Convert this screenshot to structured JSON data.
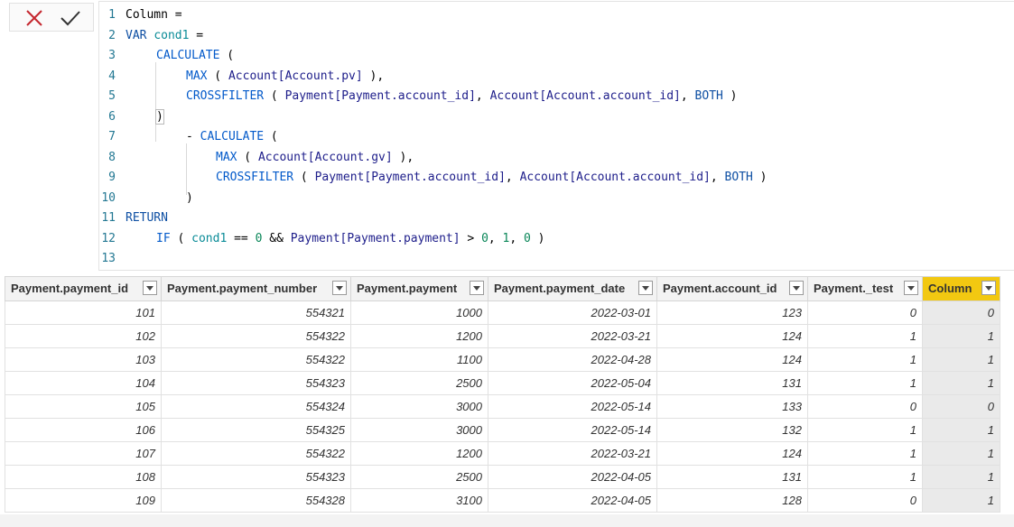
{
  "toolbar": {
    "cancel_icon": "x-icon",
    "commit_icon": "check-icon"
  },
  "formula": {
    "lines": [
      {
        "n": "1"
      },
      {
        "n": "2"
      },
      {
        "n": "3"
      },
      {
        "n": "4"
      },
      {
        "n": "5"
      },
      {
        "n": "6"
      },
      {
        "n": "7"
      },
      {
        "n": "8"
      },
      {
        "n": "9"
      },
      {
        "n": "10"
      },
      {
        "n": "11"
      },
      {
        "n": "12"
      },
      {
        "n": "13"
      }
    ],
    "t": {
      "l1": "Column =",
      "l2a": "VAR ",
      "l2b": "cond1",
      "l2c": " =",
      "l3a": "CALCULATE",
      "l3b": " (",
      "l4a": "MAX",
      "l4b": " ( ",
      "l4c": "Account[Account.pv]",
      "l4d": " ),",
      "l5a": "CROSSFILTER",
      "l5b": " ( ",
      "l5c": "Payment[Payment.account_id]",
      "l5d": ", ",
      "l5e": "Account[Account.account_id]",
      "l5f": ", ",
      "l5g": "BOTH",
      "l5h": " )",
      "l6a": ")",
      "l7a": "- ",
      "l7b": "CALCULATE",
      "l7c": " (",
      "l8a": "MAX",
      "l8b": " ( ",
      "l8c": "Account[Account.gv]",
      "l8d": " ),",
      "l9a": "CROSSFILTER",
      "l9b": " ( ",
      "l9c": "Payment[Payment.account_id]",
      "l9d": ", ",
      "l9e": "Account[Account.account_id]",
      "l9f": ", ",
      "l9g": "BOTH",
      "l9h": " )",
      "l10a": ")",
      "l11a": "RETURN",
      "l12a": "IF",
      "l12b": " ( ",
      "l12c": "cond1",
      "l12d": " == ",
      "l12e": "0",
      "l12f": " && ",
      "l12g": "Payment[Payment.payment]",
      "l12h": " > ",
      "l12i": "0",
      "l12j": ", ",
      "l12k": "1",
      "l12l": ", ",
      "l12m": "0",
      "l12n": " )"
    }
  },
  "table": {
    "columns": [
      "Payment.payment_id",
      "Payment.payment_number",
      "Payment.payment",
      "Payment.payment_date",
      "Payment.account_id",
      "Payment._test",
      "Column"
    ],
    "selected_column_color": "#f2c811",
    "rows": [
      [
        "101",
        "554321",
        "1000",
        "2022-03-01",
        "123",
        "0",
        "0"
      ],
      [
        "102",
        "554322",
        "1200",
        "2022-03-21",
        "124",
        "1",
        "1"
      ],
      [
        "103",
        "554322",
        "1100",
        "2022-04-28",
        "124",
        "1",
        "1"
      ],
      [
        "104",
        "554323",
        "2500",
        "2022-05-04",
        "131",
        "1",
        "1"
      ],
      [
        "105",
        "554324",
        "3000",
        "2022-05-14",
        "133",
        "0",
        "0"
      ],
      [
        "106",
        "554325",
        "3000",
        "2022-05-14",
        "132",
        "1",
        "1"
      ],
      [
        "107",
        "554322",
        "1200",
        "2022-03-21",
        "124",
        "1",
        "1"
      ],
      [
        "108",
        "554323",
        "2500",
        "2022-04-05",
        "131",
        "1",
        "1"
      ],
      [
        "109",
        "554328",
        "3100",
        "2022-04-05",
        "128",
        "0",
        "1"
      ]
    ]
  }
}
